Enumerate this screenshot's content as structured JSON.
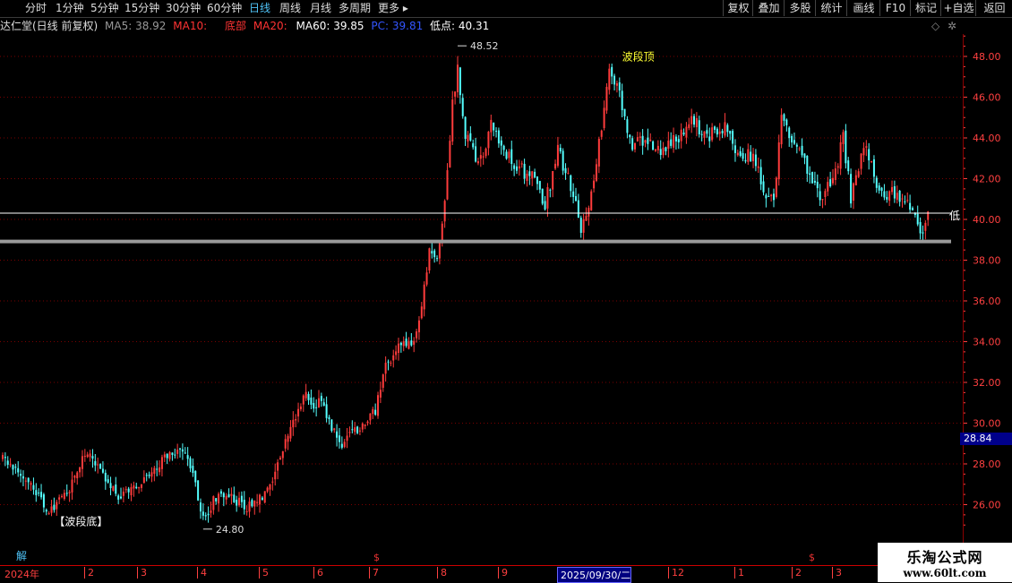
{
  "toolbar": {
    "periods": [
      {
        "label": "分时",
        "active": false
      },
      {
        "label": "1分钟",
        "active": false
      },
      {
        "label": "5分钟",
        "active": false
      },
      {
        "label": "15分钟",
        "active": false
      },
      {
        "label": "30分钟",
        "active": false
      },
      {
        "label": "60分钟",
        "active": false
      },
      {
        "label": "日线",
        "active": true
      },
      {
        "label": "周线",
        "active": false
      },
      {
        "label": "月线",
        "active": false
      },
      {
        "label": "多周期",
        "active": false
      },
      {
        "label": "更多 ▸",
        "active": false
      }
    ],
    "buttons": [
      "复权",
      "叠加",
      "多股",
      "统计",
      "画线",
      "F10",
      "标记",
      "+自选",
      "返回"
    ]
  },
  "info": {
    "title": "达仁堂(日线 前复权)",
    "ma5_label": "MA5: 38.92",
    "ma10_label": "MA10:",
    "bottom_label": "底部",
    "ma20_label": "MA20:",
    "ma60_label": "MA60: 39.85",
    "pc_label": "PC: 39.81",
    "low_label": "低点: 40.31"
  },
  "colors": {
    "up": "#ff3c3c",
    "down": "#54ffff",
    "grid": "#7a0000",
    "axis": "#ff4040",
    "ma5": "#999999",
    "ma10": "#ff3333",
    "bottom": "#ff3333",
    "ma60": "#ffffff",
    "pc": "#3355ff",
    "low": "#ffffff",
    "wave_top": "#ffff33",
    "annot": "#dddddd"
  },
  "chart_data": {
    "type": "candlestick",
    "y_ticks": [
      "48.00",
      "46.00",
      "44.00",
      "42.00",
      "40.00",
      "38.00",
      "36.00",
      "34.00",
      "32.00",
      "30.00",
      "28.00",
      "26.00"
    ],
    "ylim": [
      24.3,
      50.0
    ],
    "x_labels": [
      "2024年",
      "2",
      "3",
      "4",
      "5",
      "6",
      "7",
      "8",
      "9",
      "2025/09/30/二",
      "12",
      "1",
      "2",
      "3"
    ],
    "current_price": "28.84",
    "annotations": {
      "high": "48.52",
      "low": "24.80",
      "wave_top": "波段顶",
      "wave_bottom": "【波段底】",
      "low_mark": "低"
    },
    "horizontal_levels": [
      40.31,
      38.92
    ],
    "anchors": [
      {
        "i": 0,
        "p": 28.3
      },
      {
        "i": 8,
        "p": 27.5
      },
      {
        "i": 14,
        "p": 26.5
      },
      {
        "i": 18,
        "p": 25.6
      },
      {
        "i": 25,
        "p": 26.5
      },
      {
        "i": 32,
        "p": 28.6
      },
      {
        "i": 38,
        "p": 27.8
      },
      {
        "i": 45,
        "p": 26.4
      },
      {
        "i": 52,
        "p": 26.9
      },
      {
        "i": 58,
        "p": 27.6
      },
      {
        "i": 64,
        "p": 28.4
      },
      {
        "i": 70,
        "p": 28.8
      },
      {
        "i": 74,
        "p": 27.5
      },
      {
        "i": 78,
        "p": 25.3
      },
      {
        "i": 84,
        "p": 26.6
      },
      {
        "i": 90,
        "p": 26.3
      },
      {
        "i": 95,
        "p": 25.8
      },
      {
        "i": 102,
        "p": 26.4
      },
      {
        "i": 108,
        "p": 28.3
      },
      {
        "i": 114,
        "p": 30.4
      },
      {
        "i": 118,
        "p": 31.4
      },
      {
        "i": 121,
        "p": 30.9
      },
      {
        "i": 124,
        "p": 31.1
      },
      {
        "i": 128,
        "p": 29.7
      },
      {
        "i": 132,
        "p": 29.0
      },
      {
        "i": 138,
        "p": 29.7
      },
      {
        "i": 145,
        "p": 30.6
      },
      {
        "i": 149,
        "p": 32.8
      },
      {
        "i": 155,
        "p": 34.0
      },
      {
        "i": 160,
        "p": 33.8
      },
      {
        "i": 163,
        "p": 35.8
      },
      {
        "i": 166,
        "p": 38.5
      },
      {
        "i": 169,
        "p": 38.0
      },
      {
        "i": 172,
        "p": 40.6
      },
      {
        "i": 175,
        "p": 45.5
      },
      {
        "i": 177,
        "p": 47.5
      },
      {
        "i": 180,
        "p": 44.0
      },
      {
        "i": 186,
        "p": 42.8
      },
      {
        "i": 190,
        "p": 44.8
      },
      {
        "i": 195,
        "p": 43.5
      },
      {
        "i": 200,
        "p": 42.6
      },
      {
        "i": 206,
        "p": 42.0
      },
      {
        "i": 211,
        "p": 40.7
      },
      {
        "i": 216,
        "p": 43.4
      },
      {
        "i": 221,
        "p": 41.6
      },
      {
        "i": 225,
        "p": 39.6
      },
      {
        "i": 228,
        "p": 40.9
      },
      {
        "i": 232,
        "p": 43.6
      },
      {
        "i": 236,
        "p": 47.3
      },
      {
        "i": 240,
        "p": 46.1
      },
      {
        "i": 244,
        "p": 43.7
      },
      {
        "i": 250,
        "p": 43.9
      },
      {
        "i": 256,
        "p": 43.4
      },
      {
        "i": 262,
        "p": 43.9
      },
      {
        "i": 268,
        "p": 44.9
      },
      {
        "i": 274,
        "p": 44.1
      },
      {
        "i": 280,
        "p": 44.6
      },
      {
        "i": 286,
        "p": 43.4
      },
      {
        "i": 292,
        "p": 43.0
      },
      {
        "i": 297,
        "p": 41.2
      },
      {
        "i": 300,
        "p": 40.9
      },
      {
        "i": 303,
        "p": 44.9
      },
      {
        "i": 307,
        "p": 43.8
      },
      {
        "i": 312,
        "p": 42.8
      },
      {
        "i": 318,
        "p": 41.0
      },
      {
        "i": 323,
        "p": 41.9
      },
      {
        "i": 327,
        "p": 44.0
      },
      {
        "i": 330,
        "p": 41.1
      },
      {
        "i": 335,
        "p": 43.8
      },
      {
        "i": 338,
        "p": 42.7
      },
      {
        "i": 341,
        "p": 41.1
      },
      {
        "i": 346,
        "p": 41.3
      },
      {
        "i": 350,
        "p": 40.9
      },
      {
        "i": 355,
        "p": 40.2
      },
      {
        "i": 358,
        "p": 39.3
      },
      {
        "i": 360,
        "p": 40.2
      }
    ]
  }
}
